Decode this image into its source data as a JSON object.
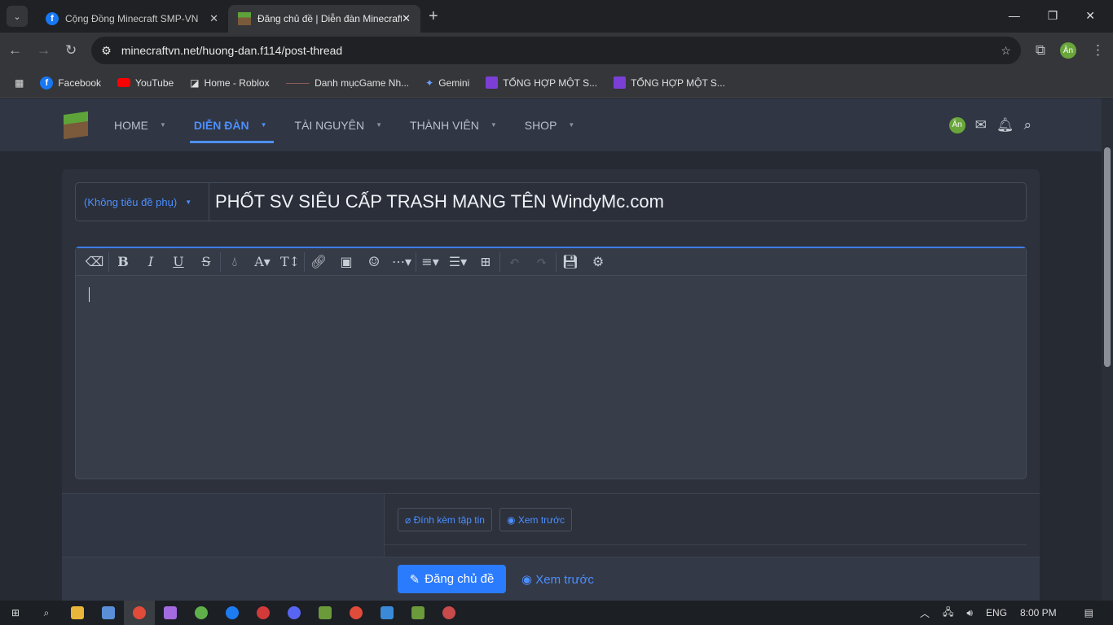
{
  "browser": {
    "tabs": [
      {
        "title": "Cộng Đồng Minecraft SMP-VN"
      },
      {
        "title": "Đăng chủ đề | Diễn đàn Minecraft"
      }
    ],
    "url": "minecraftvn.net/huong-dan.f114/post-thread",
    "profile": "Ân",
    "bookmarks": [
      "Facebook",
      "YouTube",
      "Home - Roblox",
      "Danh mụcGame Nh...",
      "Gemini",
      "TỔNG HỢP MỘT S...",
      "TỔNG HỢP MỘT S..."
    ]
  },
  "nav": {
    "items": [
      "HOME",
      "DIỄN ĐÀN",
      "TÀI NGUYÊN",
      "THÀNH VIÊN",
      "SHOP"
    ],
    "avatar": "Ân"
  },
  "form": {
    "prefix": "(Không tiêu đề phụ)",
    "title": "PHỐT SV SIÊU CẤP TRASH MANG TÊN WindyMc.com",
    "attach": "Đính kèm tập tin",
    "preview_small": "Xem trước",
    "submit": "Đăng chủ đề",
    "preview": "Xem trước"
  },
  "taskbar": {
    "lang": "ENG",
    "time": "8:00 PM"
  },
  "colors": {
    "accent": "#2b7bff",
    "link": "#4d8fff"
  }
}
